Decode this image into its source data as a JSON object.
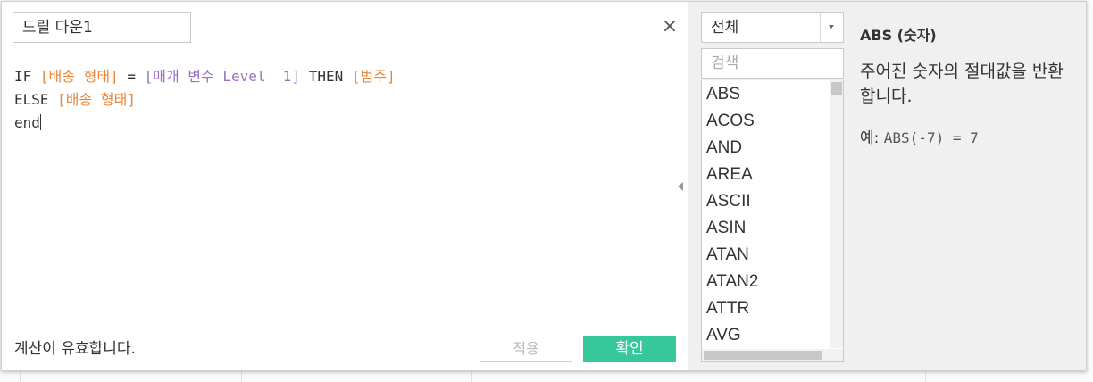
{
  "editor": {
    "calc_name": "드릴 다운1",
    "close_symbol": "×",
    "code_lines": [
      [
        {
          "t": "IF ",
          "c": "kw"
        },
        {
          "t": "[배송 형태]",
          "c": "field"
        },
        {
          "t": " = ",
          "c": "kw"
        },
        {
          "t": "[매개 변수 Level  1]",
          "c": "param"
        },
        {
          "t": " THEN ",
          "c": "kw"
        },
        {
          "t": "[범주]",
          "c": "field"
        }
      ],
      [
        {
          "t": "ELSE ",
          "c": "kw"
        },
        {
          "t": "[배송 형태]",
          "c": "field"
        }
      ],
      [
        {
          "t": "end",
          "c": "kw",
          "caret": true
        }
      ]
    ],
    "status": "계산이 유효합니다.",
    "apply_label": "적용",
    "ok_label": "확인"
  },
  "functions": {
    "category": "전체",
    "search_placeholder": "검색",
    "items": [
      "ABS",
      "ACOS",
      "AND",
      "AREA",
      "ASCII",
      "ASIN",
      "ATAN",
      "ATAN2",
      "ATTR",
      "AVG"
    ]
  },
  "help": {
    "title": "ABS (숫자)",
    "description": "주어진 숫자의 절대값을 반환합니다.",
    "example_prefix": "예:",
    "example_code": "ABS(-7) = 7"
  },
  "colors": {
    "field": "#e8873a",
    "parameter": "#9c6fc3",
    "ok_button": "#36c79a"
  }
}
